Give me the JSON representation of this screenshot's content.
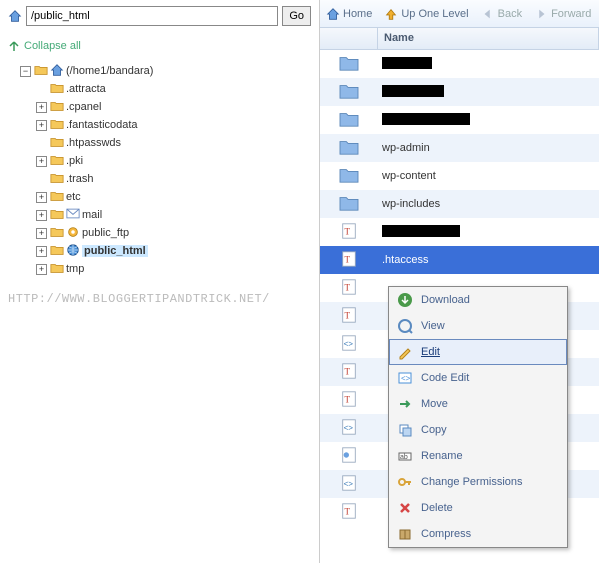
{
  "path_input": {
    "value": "/public_html",
    "go_label": "Go"
  },
  "collapse_all_label": "Collapse all",
  "tree": {
    "root_label": "(/home1/bandara)",
    "items": [
      {
        "label": ".attracta",
        "expander": "none"
      },
      {
        "label": ".cpanel",
        "expander": "plus"
      },
      {
        "label": ".fantasticodata",
        "expander": "plus"
      },
      {
        "label": ".htpasswds",
        "expander": "none"
      },
      {
        "label": ".pki",
        "expander": "plus"
      },
      {
        "label": ".trash",
        "expander": "none"
      },
      {
        "label": "etc",
        "expander": "plus"
      },
      {
        "label": "mail",
        "expander": "plus",
        "icon": "mail"
      },
      {
        "label": "public_ftp",
        "expander": "plus",
        "icon": "ftp"
      },
      {
        "label": "public_html",
        "expander": "plus",
        "icon": "globe",
        "selected": true
      },
      {
        "label": "tmp",
        "expander": "plus"
      }
    ]
  },
  "watermark": "HTTP://WWW.BLOGGERTIPANDTRICK.NET/",
  "toolbar": {
    "home": "Home",
    "up": "Up One Level",
    "back": "Back",
    "forward": "Forward"
  },
  "columns": {
    "name": "Name"
  },
  "rows": [
    {
      "type": "folder",
      "label": "",
      "redacted": true,
      "redact_w": 50
    },
    {
      "type": "folder",
      "label": "",
      "redacted": true,
      "redact_w": 62
    },
    {
      "type": "folder",
      "label": "",
      "redacted": true,
      "redact_w": 88
    },
    {
      "type": "folder",
      "label": "wp-admin"
    },
    {
      "type": "folder",
      "label": "wp-content"
    },
    {
      "type": "folder",
      "label": "wp-includes"
    },
    {
      "type": "file",
      "label": "",
      "redacted": true,
      "redact_w": 78
    },
    {
      "type": "file",
      "label": ".htaccess",
      "selected": true,
      "file_icon": "text"
    },
    {
      "type": "file",
      "label": "",
      "file_icon": "text"
    },
    {
      "type": "file",
      "label": "",
      "file_icon": "text"
    },
    {
      "type": "file",
      "label": "",
      "file_icon": "code"
    },
    {
      "type": "file",
      "label": "",
      "file_icon": "text"
    },
    {
      "type": "file",
      "label": "",
      "file_icon": "text"
    },
    {
      "type": "file",
      "label": "",
      "file_icon": "code"
    },
    {
      "type": "file",
      "label": "",
      "file_icon": "image"
    },
    {
      "type": "file",
      "label": "",
      "file_icon": "code"
    },
    {
      "type": "file",
      "label": "",
      "file_icon": "text"
    }
  ],
  "context_menu": {
    "items": [
      {
        "label": "Download",
        "icon": "download"
      },
      {
        "label": "View",
        "icon": "view"
      },
      {
        "label": "Edit",
        "icon": "edit",
        "selected": true
      },
      {
        "label": "Code Edit",
        "icon": "code"
      },
      {
        "label": "Move",
        "icon": "move"
      },
      {
        "label": "Copy",
        "icon": "copy"
      },
      {
        "label": "Rename",
        "icon": "rename"
      },
      {
        "label": "Change Permissions",
        "icon": "key"
      },
      {
        "label": "Delete",
        "icon": "delete"
      },
      {
        "label": "Compress",
        "icon": "compress"
      }
    ]
  }
}
